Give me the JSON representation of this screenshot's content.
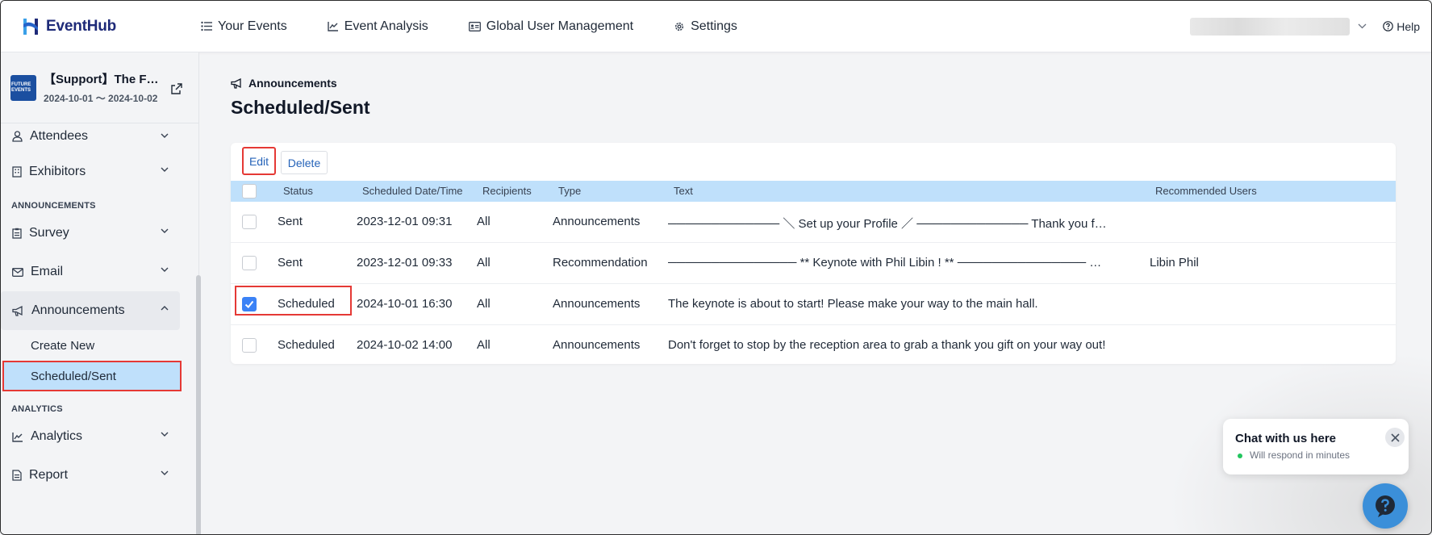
{
  "app": {
    "name": "EventHub",
    "brand_color": "#1e2a78"
  },
  "topnav": {
    "items": [
      {
        "label": "Your Events",
        "icon": "list-icon"
      },
      {
        "label": "Event Analysis",
        "icon": "line-chart-icon"
      },
      {
        "label": "Global User Management",
        "icon": "id-card-icon"
      },
      {
        "label": "Settings",
        "icon": "gear-icon"
      }
    ],
    "help_label": "Help"
  },
  "event": {
    "thumb_text": "FUTURE EVENTS",
    "title": "【Support】The F…",
    "dates": "2024-10-01 〜 2024-10-02"
  },
  "sidebar": {
    "attendees": "Attendees",
    "exhibitors": "Exhibitors",
    "section_announcements": "ANNOUNCEMENTS",
    "survey": "Survey",
    "email": "Email",
    "announcements": "Announcements",
    "create_new": "Create New",
    "scheduled_sent": "Scheduled/Sent",
    "section_analytics": "ANALYTICS",
    "analytics": "Analytics",
    "report": "Report"
  },
  "main": {
    "breadcrumb": "Announcements",
    "title": "Scheduled/Sent",
    "edit_label": "Edit",
    "delete_label": "Delete"
  },
  "table": {
    "columns": [
      "Status",
      "Scheduled Date/Time",
      "Recipients",
      "Type",
      "Text",
      "Recommended Users"
    ],
    "rows": [
      {
        "checked": false,
        "status": "Sent",
        "datetime": "2023-12-01 09:31",
        "recipients": "All",
        "type": "Announcements",
        "text": "───────────── ＼ Set up your Profile ／ ───────────── Thank you f…",
        "recommended": ""
      },
      {
        "checked": false,
        "status": "Sent",
        "datetime": "2023-12-01 09:33",
        "recipients": "All",
        "type": "Recommendation",
        "text": "─────────────── ** Keynote with Phil Libin ! ** ─────────────── …",
        "recommended": "Libin Phil"
      },
      {
        "checked": true,
        "status": "Scheduled",
        "datetime": "2024-10-01 16:30",
        "recipients": "All",
        "type": "Announcements",
        "text": "The keynote is about to start! Please make your way to the main hall.",
        "recommended": ""
      },
      {
        "checked": false,
        "status": "Scheduled",
        "datetime": "2024-10-02 14:00",
        "recipients": "All",
        "type": "Announcements",
        "text": "Don't forget to stop by the reception area to grab a thank you gift on your way out!",
        "recommended": ""
      }
    ]
  },
  "chat": {
    "title": "Chat with us here",
    "subtitle": "Will respond in minutes"
  }
}
